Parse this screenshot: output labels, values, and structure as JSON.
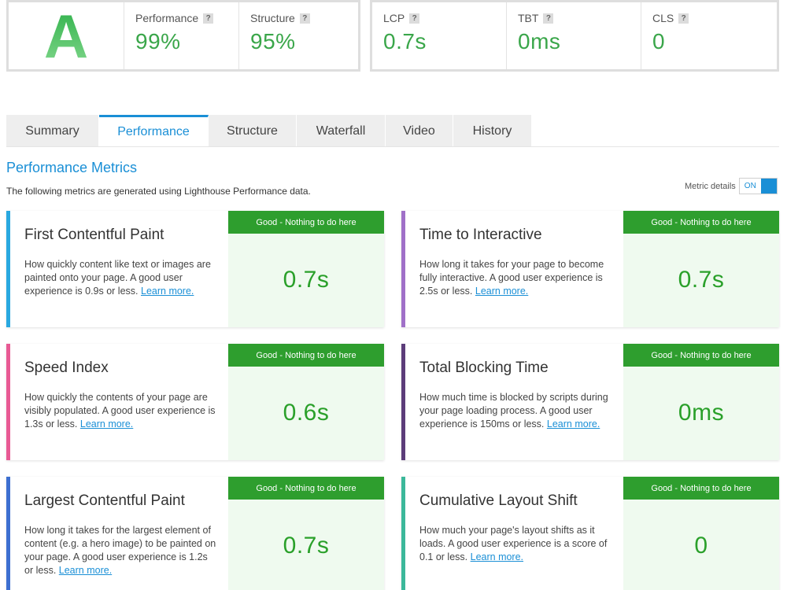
{
  "summary": {
    "grade": "A",
    "performance": {
      "label": "Performance",
      "value": "99%"
    },
    "structure": {
      "label": "Structure",
      "value": "95%"
    },
    "lcp": {
      "label": "LCP",
      "value": "0.7s"
    },
    "tbt": {
      "label": "TBT",
      "value": "0ms"
    },
    "cls": {
      "label": "CLS",
      "value": "0"
    },
    "help_glyph": "?"
  },
  "tabs": [
    "Summary",
    "Performance",
    "Structure",
    "Waterfall",
    "Video",
    "History"
  ],
  "active_tab": "Performance",
  "section": {
    "title": "Performance Metrics",
    "description": "The following metrics are generated using Lighthouse Performance data.",
    "metric_details_label": "Metric details",
    "toggle_label": "ON"
  },
  "cards": [
    {
      "name": "First Contentful Paint",
      "desc": "How quickly content like text or images are painted onto your page. A good user experience is 0.9s or less.",
      "link": "Learn more.",
      "badge": "Good - Nothing to do here",
      "value": "0.7s",
      "color": "#29a8e0"
    },
    {
      "name": "Time to Interactive",
      "desc": "How long it takes for your page to become fully interactive. A good user experience is 2.5s or less.",
      "link": "Learn more.",
      "badge": "Good - Nothing to do here",
      "value": "0.7s",
      "color": "#a070c8"
    },
    {
      "name": "Speed Index",
      "desc": "How quickly the contents of your page are visibly populated. A good user experience is 1.3s or less.",
      "link": "Learn more.",
      "badge": "Good - Nothing to do here",
      "value": "0.6s",
      "color": "#e85a94"
    },
    {
      "name": "Total Blocking Time",
      "desc": "How much time is blocked by scripts during your page loading process. A good user experience is 150ms or less.",
      "link": "Learn more.",
      "badge": "Good - Nothing to do here",
      "value": "0ms",
      "color": "#5c3d7a"
    },
    {
      "name": "Largest Contentful Paint",
      "desc": "How long it takes for the largest element of content (e.g. a hero image) to be painted on your page. A good user experience is 1.2s or less.",
      "link": "Learn more.",
      "badge": "Good - Nothing to do here",
      "value": "0.7s",
      "color": "#3d6fd0"
    },
    {
      "name": "Cumulative Layout Shift",
      "desc": "How much your page's layout shifts as it loads. A good user experience is a score of 0.1 or less.",
      "link": "Learn more.",
      "badge": "Good - Nothing to do here",
      "value": "0",
      "color": "#3bb89a"
    }
  ]
}
